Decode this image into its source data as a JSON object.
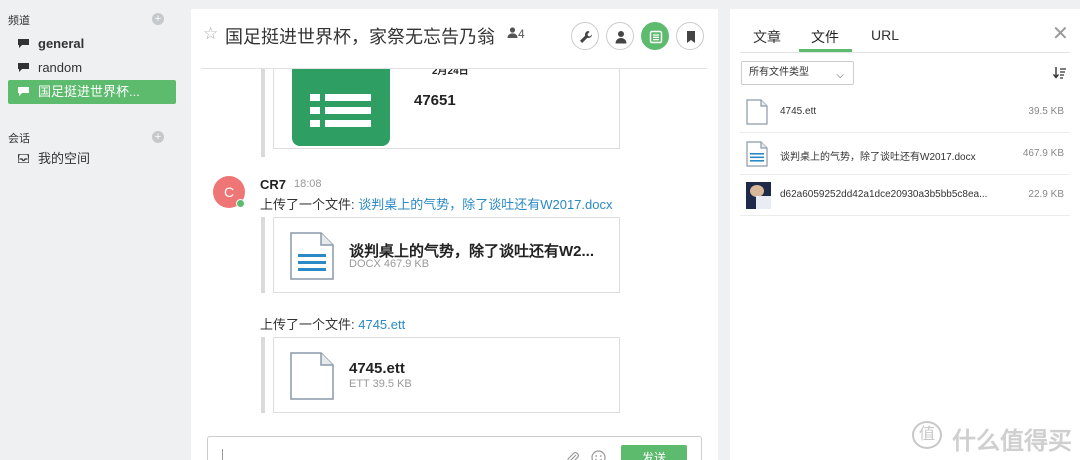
{
  "sidebar": {
    "channels_label": "频道",
    "channels_add": "+",
    "channels": [
      {
        "label": "general"
      },
      {
        "label": "random"
      },
      {
        "label": "国足挺进世界杯..."
      }
    ],
    "conversations_label": "会话",
    "conversations_add": "+",
    "conversations": [
      {
        "label": "我的空间"
      }
    ]
  },
  "room": {
    "star": "☆",
    "title": "国足挺进世界杯，家祭无忘告乃翁",
    "member_count": "4"
  },
  "messages": {
    "spreadsheet_card": {
      "date": "2月24日",
      "name": "47651"
    },
    "author_initial": "C",
    "author": "CR7",
    "time": "18:08",
    "uploads": [
      {
        "prefix": "上传了一个文件: ",
        "link": "谈判桌上的气势，除了谈吐还有W2017.docx",
        "card_name": "谈判桌上的气势，除了谈吐还有W2...",
        "card_meta": "DOCX 467.9 KB"
      },
      {
        "prefix": "上传了一个文件: ",
        "link": "4745.ett",
        "card_name": "4745.ett",
        "card_meta": "ETT 39.5 KB"
      }
    ]
  },
  "composer": {
    "send_label": "发送"
  },
  "panel": {
    "tabs": [
      {
        "label": "文章"
      },
      {
        "label": "文件"
      },
      {
        "label": "URL"
      }
    ],
    "close": "✕",
    "filter_label": "所有文件类型",
    "filter_chevron": "⌵",
    "files": [
      {
        "name": "4745.ett",
        "size": "39.5 KB"
      },
      {
        "name": "谈判桌上的气势，除了谈吐还有W2017.docx",
        "size": "467.9 KB"
      },
      {
        "name": "d62a6059252dd42a1dce20930a3b5bb5c8ea...",
        "size": "22.9 KB"
      }
    ]
  },
  "watermark": {
    "symbol": "值",
    "text": "什么值得买"
  },
  "colors": {
    "accent": "#5dbb6e",
    "link": "#2a8ac6",
    "avatar": "#ef7676",
    "spreadsheet": "#2e9e63"
  }
}
